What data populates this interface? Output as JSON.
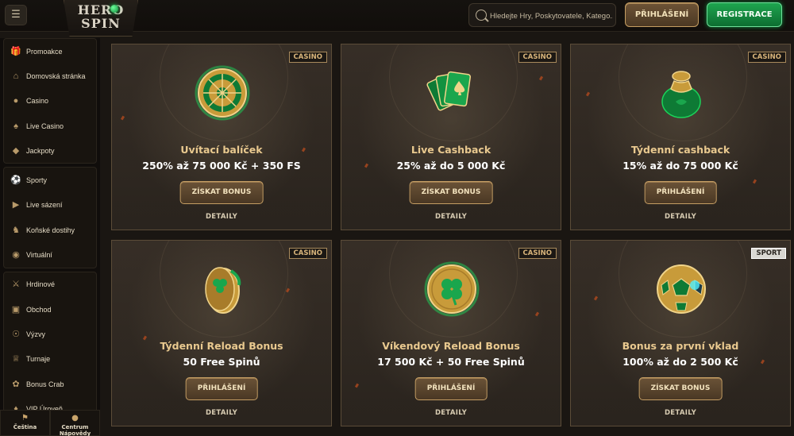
{
  "header": {
    "menu_icon": "sidebar-toggle-icon",
    "logo_line1": "HERO",
    "logo_line2": "SPIN",
    "search_placeholder": "Hledejte Hry, Poskytovatele, Katego...",
    "login_label": "PŘIHLÁŠENÍ",
    "register_label": "REGISTRACE"
  },
  "sidebar": {
    "groups": [
      [
        {
          "label": "Promoakce",
          "icon": "gift-icon"
        },
        {
          "label": "Domovská stránka",
          "icon": "home-icon"
        },
        {
          "label": "Casino",
          "icon": "cherries-icon"
        },
        {
          "label": "Live Casino",
          "icon": "cards-icon"
        },
        {
          "label": "Jackpoty",
          "icon": "jackpot-icon"
        }
      ],
      [
        {
          "label": "Sporty",
          "icon": "football-icon"
        },
        {
          "label": "Live sázení",
          "icon": "live-icon"
        },
        {
          "label": "Koňské dostihy",
          "icon": "horse-icon"
        },
        {
          "label": "Virtuální",
          "icon": "gamepad-icon"
        }
      ],
      [
        {
          "label": "Hrdinové",
          "icon": "swords-icon"
        },
        {
          "label": "Obchod",
          "icon": "shop-icon"
        },
        {
          "label": "Výzvy",
          "icon": "medal-icon"
        },
        {
          "label": "Turnaje",
          "icon": "trophy-icon"
        },
        {
          "label": "Bonus Crab",
          "icon": "crab-icon"
        },
        {
          "label": "VIP Úroveň",
          "icon": "vip-icon"
        }
      ]
    ],
    "bottom": {
      "language_label": "Čeština",
      "help_label": "Centrum Nápovědy"
    }
  },
  "cards": [
    {
      "tag": "CASINO",
      "title": "Uvítací balíček",
      "offer": "250% až 75 000 Kč + 350 FS",
      "button": "ZÍSKAT BONUS",
      "detail": "DETAILY",
      "icon": "roulette-wheel-icon"
    },
    {
      "tag": "CASINO",
      "title": "Live Cashback",
      "offer": "25% až do 5 000 Kč",
      "button": "ZÍSKAT BONUS",
      "detail": "DETAILY",
      "icon": "playing-cards-icon"
    },
    {
      "tag": "CASINO",
      "title": "Týdenní cashback",
      "offer": "15% až do 75 000 Kč",
      "button": "PŘIHLÁŠENÍ",
      "detail": "DETAILY",
      "icon": "money-bag-icon"
    },
    {
      "tag": "CASINO",
      "title": "Týdenní Reload Bonus",
      "offer": "50 Free Spinů",
      "button": "PŘIHLÁŠENÍ",
      "detail": "DETAILY",
      "icon": "coin-stack-icon"
    },
    {
      "tag": "CASINO",
      "title": "Víkendový Reload Bonus",
      "offer": "17 500 Kč + 50 Free Spinů",
      "button": "PŘIHLÁŠENÍ",
      "detail": "DETAILY",
      "icon": "clover-coin-icon"
    },
    {
      "tag": "SPORT",
      "title": "Bonus za první vklad",
      "offer": "100% až do 2 500 Kč",
      "button": "ZÍSKAT BONUS",
      "detail": "DETAILY",
      "icon": "football-ball-icon"
    }
  ],
  "colors": {
    "background": "#1a1612",
    "gold": "#c49d63",
    "green": "#1ea44f",
    "title_gold": "#e9c98f"
  }
}
